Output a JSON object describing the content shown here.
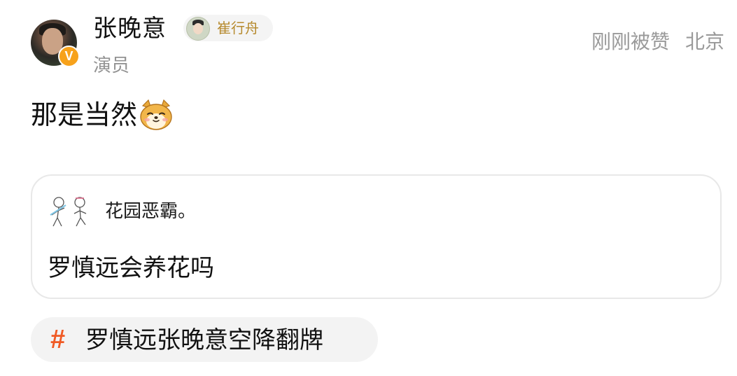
{
  "post": {
    "author": {
      "name": "张晚意",
      "title": "演员",
      "verified_mark": "V",
      "badge_label": "崔行舟"
    },
    "meta": {
      "status": "刚刚被赞",
      "location": "北京"
    },
    "content": {
      "text": "那是当然",
      "emoji": "shiba-dog-emoji"
    },
    "quote": {
      "author": "花园恶霸。",
      "text": "罗慎远会养花吗"
    },
    "topic": {
      "hash": "#",
      "label": "罗慎远张晚意空降翻牌"
    }
  },
  "colors": {
    "verified": "#f7a21b",
    "topic_hash": "#f05a24",
    "badge_text": "#b68a2e",
    "meta_text": "#9a9a9a"
  }
}
